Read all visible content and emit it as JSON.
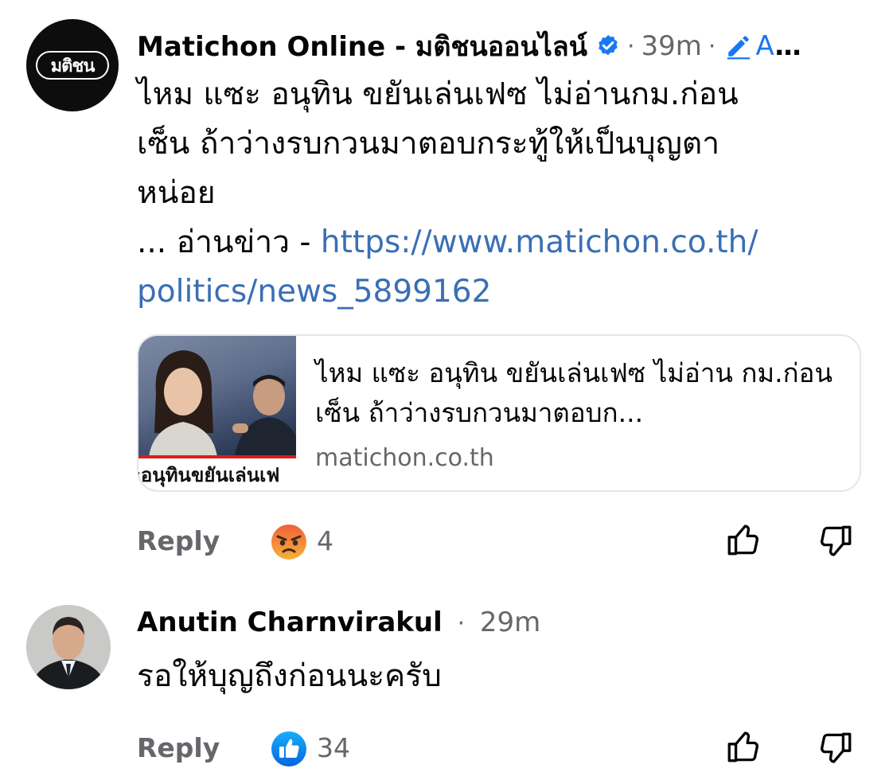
{
  "comments": [
    {
      "author": "Matichon Online - มติชนออนไลน์",
      "avatar_logo_text": "มติชน",
      "verified": true,
      "time": "39m",
      "edit_label": "A",
      "more": "...",
      "body_line1": "ไหม แซะ อนุทิน ขยันเล่นเฟซ ไม่อ่านกม.ก่อน",
      "body_line2": "เซ็น ถ้าว่างรบกวนมาตอบกระทู้ให้เป็นบุญตา",
      "body_line3": "หน่อย",
      "body_prefix": "... อ่านข่าว - ",
      "link_line1": "https://www.matichon.co.th/",
      "link_line2": "politics/news_5899162",
      "preview": {
        "thumb_banner": "ะอนุทินขยันเล่นเฟ",
        "title": "ไหม แซะ อนุทิน ขยันเล่นเฟซ ไม่อ่าน กม.ก่อนเซ็น ถ้าว่างรบกวนมาตอบก...",
        "domain": "matichon.co.th"
      },
      "reply_label": "Reply",
      "reaction_icon": "angry-reaction-icon",
      "reaction_count": "4"
    },
    {
      "author": "Anutin Charnvirakul",
      "time": "29m",
      "body": "รอให้บุญถึงก่อนนะครับ",
      "reply_label": "Reply",
      "reaction_icon": "like-reaction-icon",
      "reaction_count": "34"
    }
  ],
  "colors": {
    "text": "#050505",
    "meta": "#65676b",
    "link": "#3a6fb5",
    "accent_blue": "#1877f2",
    "border": "#e4e6eb"
  },
  "icons": {
    "verified": "verified-badge-icon",
    "edit": "pencil-icon",
    "upvote": "thumbs-up-outline-icon",
    "downvote": "thumbs-down-outline-icon"
  }
}
